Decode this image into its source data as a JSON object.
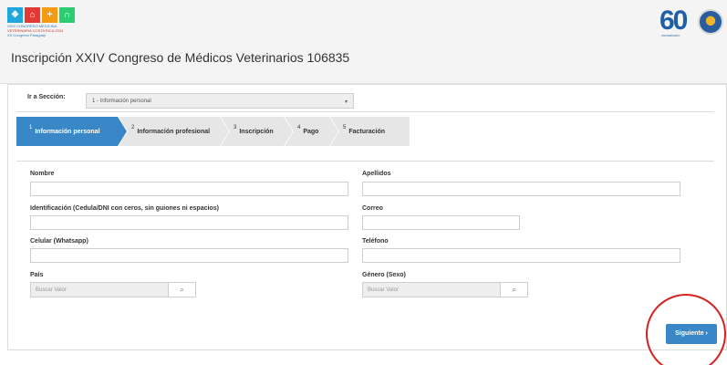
{
  "header": {
    "logo_lines": [
      "XXIV CONGRESO MEDICINA",
      "VETERINARIA COSTA RICA 2024",
      "XX Congreso Paraguay"
    ],
    "anniversary_number": "60",
    "anniversary_caption": "ANIVERSARIO",
    "title": "Inscripción XXIV Congreso de Médicos Veterinarios 106835"
  },
  "section_selector": {
    "label": "Ir a Sección:",
    "selected": "1 - Información personal"
  },
  "wizard": {
    "steps": [
      {
        "num": "1",
        "label": "Información personal",
        "active": true
      },
      {
        "num": "2",
        "label": "Información profesional",
        "active": false
      },
      {
        "num": "3",
        "label": "Inscripción",
        "active": false
      },
      {
        "num": "4",
        "label": "Pago",
        "active": false
      },
      {
        "num": "5",
        "label": "Facturación",
        "active": false
      }
    ]
  },
  "form": {
    "nombre": {
      "label": "Nombre",
      "value": ""
    },
    "apellidos": {
      "label": "Apellidos",
      "value": ""
    },
    "identificacion": {
      "label": "Identificación (Cedula/DNI con ceros, sin guiones ni espacios)",
      "value": ""
    },
    "correo": {
      "label": "Correo",
      "value": ""
    },
    "celular": {
      "label": "Celular (Whatsapp)",
      "value": ""
    },
    "telefono": {
      "label": "Teléfono",
      "value": ""
    },
    "pais": {
      "label": "País",
      "placeholder": "Buscar Valor"
    },
    "genero": {
      "label": "Género (Sexo)",
      "placeholder": "Buscar Valor"
    }
  },
  "actions": {
    "next_label": "Siguiente ›"
  },
  "colors": {
    "accent": "#3a87c7",
    "highlight": "#d81e1e"
  }
}
